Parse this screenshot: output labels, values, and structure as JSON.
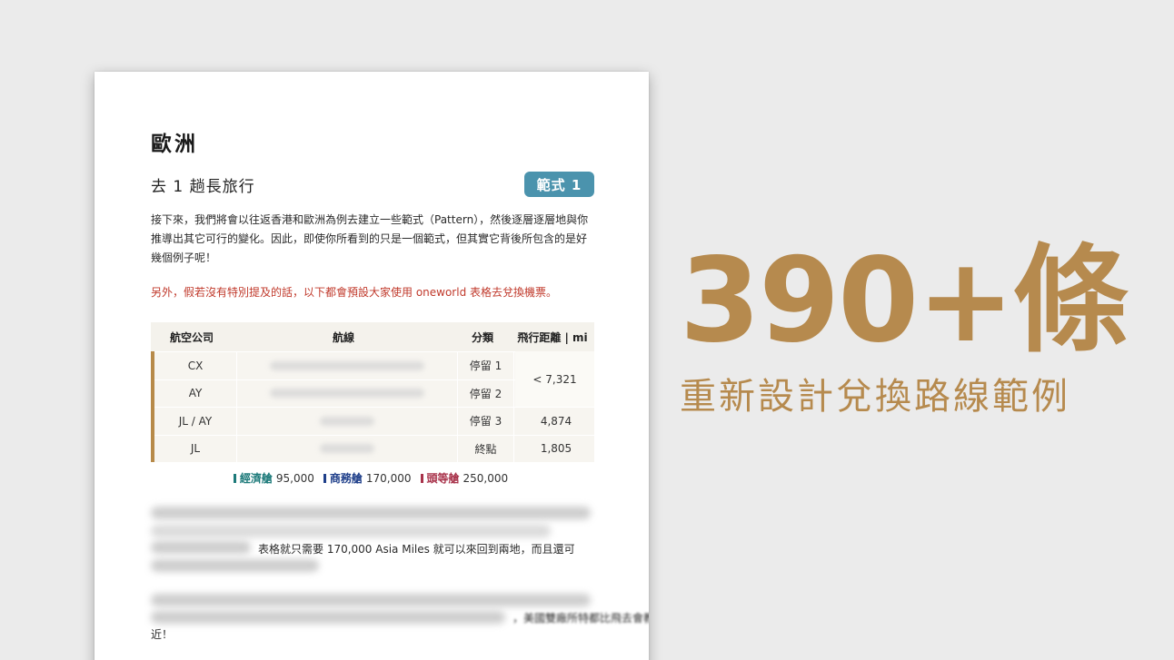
{
  "document": {
    "region_title": "歐洲",
    "trip_title": "去 1 趟長旅行",
    "pattern_badge": "範式 1",
    "intro_text": "接下來，我們將會以往返香港和歐洲為例去建立一些範式（Pattern），然後逐層逐層地與你推導出其它可行的變化。因此，即使你所看到的只是一個範式，但其實它背後所包含的是好幾個例子呢！",
    "note_text": "另外，假若沒有特別提及的話，以下都會預設大家使用 oneworld 表格去兌換機票。",
    "table": {
      "headers": [
        "航空公司",
        "航線",
        "分類",
        "飛行距離 | mi"
      ],
      "rows": [
        {
          "airline": "CX",
          "type": "停留 1"
        },
        {
          "airline": "AY",
          "type": "停留 2"
        },
        {
          "airline": "JL / AY",
          "type": "停留 3",
          "distance": "4,874"
        },
        {
          "airline": "JL",
          "type": "終點",
          "distance": "1,805"
        }
      ],
      "merged_distance": "< 7,321"
    },
    "legend": [
      {
        "label": "經濟艙",
        "value": "95,000",
        "color": "#1d7a7a"
      },
      {
        "label": "商務艙",
        "value": "170,000",
        "color": "#1f3f8a"
      },
      {
        "label": "頭等艙",
        "value": "250,000",
        "color": "#a8324a"
      }
    ],
    "paragraph_visible": "表格就只需要 170,000 Asia Miles 就可以來回到兩地，而且還可",
    "paragraph_tail": "，美國雙廠所特都比飛去會教",
    "paragraph_end": "近！"
  },
  "headline": {
    "main": "390+條",
    "sub": "重新設計兌換路線範例"
  },
  "colors": {
    "background": "#ebebeb",
    "gold": "#b68a4e",
    "badge": "#4b93ad",
    "note_red": "#c0392b"
  }
}
